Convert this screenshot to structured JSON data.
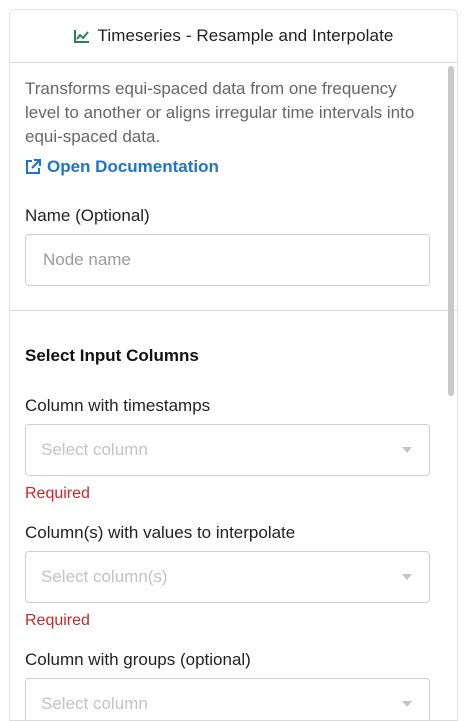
{
  "header": {
    "title": "Timeseries - Resample and Interpolate",
    "icon": "line-chart-icon",
    "accent": "#2e7d5b"
  },
  "description": "Transforms equi-spaced data from one frequency level to another or aligns irregular time intervals into equi-spaced data.",
  "documentation_link": {
    "label": "Open Documentation",
    "icon": "external-link-icon",
    "color": "#1f73c8"
  },
  "name_field": {
    "label": "Name (Optional)",
    "placeholder": "Node name",
    "value": ""
  },
  "input_columns": {
    "section_title": "Select Input Columns",
    "timestamps": {
      "label": "Column with timestamps",
      "placeholder": "Select column",
      "error": "Required"
    },
    "values": {
      "label": "Column(s) with values to interpolate",
      "placeholder": "Select column(s)",
      "error": "Required"
    },
    "groups": {
      "label": "Column with groups (optional)",
      "placeholder": "Select column"
    }
  },
  "colors": {
    "error": "#c62828",
    "link": "#1f73c8"
  }
}
